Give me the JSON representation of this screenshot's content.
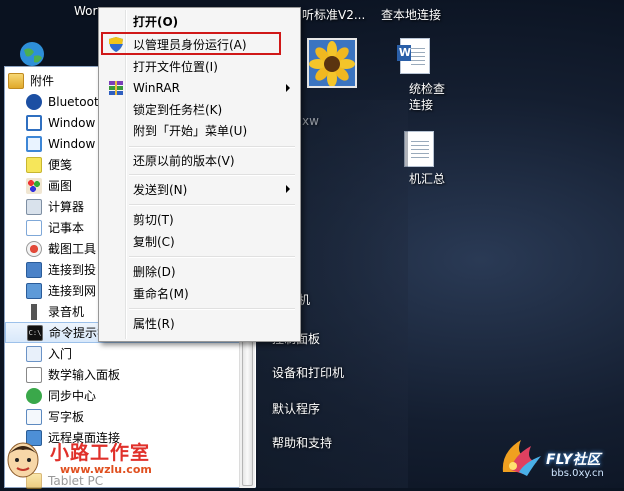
{
  "desktop": {
    "top_labels": [
      "Wor",
      "听标准V2...",
      "查本地连接"
    ],
    "icon_labels": {
      "sunflower_caption": "xw",
      "doc1_line1": "统检查",
      "doc1_line2": "连接",
      "doc2_caption": "机汇总"
    }
  },
  "start_menu": {
    "left_items": [
      {
        "label": "附件",
        "icon": "folder-icon"
      },
      {
        "label": "Bluetoot",
        "icon": "bluetooth-icon"
      },
      {
        "label": "Window",
        "icon": "window-icon"
      },
      {
        "label": "Window",
        "icon": "window-icon"
      },
      {
        "label": "便笺",
        "icon": "sticky-note-icon"
      },
      {
        "label": "画图",
        "icon": "paint-icon"
      },
      {
        "label": "计算器",
        "icon": "calculator-icon"
      },
      {
        "label": "记事本",
        "icon": "notepad-icon"
      },
      {
        "label": "截图工具",
        "icon": "snipping-tool-icon"
      },
      {
        "label": "连接到投",
        "icon": "projector-icon"
      },
      {
        "label": "连接到网",
        "icon": "network-projector-icon"
      },
      {
        "label": "录音机",
        "icon": "microphone-icon"
      },
      {
        "label": "命令提示符",
        "icon": "command-prompt-icon"
      },
      {
        "label": "入门",
        "icon": "getting-started-icon"
      },
      {
        "label": "数学输入面板",
        "icon": "math-input-icon"
      },
      {
        "label": "同步中心",
        "icon": "sync-icon"
      },
      {
        "label": "写字板",
        "icon": "wordpad-icon"
      },
      {
        "label": "远程桌面连接",
        "icon": "remote-desktop-icon"
      },
      {
        "label": "Tablet PC",
        "icon": "tablet-icon"
      }
    ],
    "right_items": [
      "机",
      "控制面板",
      "设备和打印机",
      "默认程序",
      "帮助和支持"
    ]
  },
  "context_menu": {
    "items": [
      {
        "label": "打开(O)",
        "bold": true
      },
      {
        "label": "以管理员身份运行(A)",
        "icon": "uac-shield-icon"
      },
      {
        "label": "打开文件位置(I)"
      },
      {
        "label": "WinRAR",
        "icon": "winrar-icon",
        "submenu": true
      },
      {
        "label": "锁定到任务栏(K)"
      },
      {
        "label": "附到「开始」菜单(U)"
      },
      {
        "label": "还原以前的版本(V)"
      },
      {
        "label": "发送到(N)",
        "submenu": true
      },
      {
        "label": "剪切(T)"
      },
      {
        "label": "复制(C)"
      },
      {
        "label": "删除(D)"
      },
      {
        "label": "重命名(M)"
      },
      {
        "label": "属性(R)"
      }
    ],
    "highlight_color": "#d01818"
  },
  "watermarks": {
    "left_title": "小路工作室",
    "left_url": "www.wzlu.com",
    "right_title": "FLY社区",
    "right_url": "bbs.0xy.cn"
  }
}
